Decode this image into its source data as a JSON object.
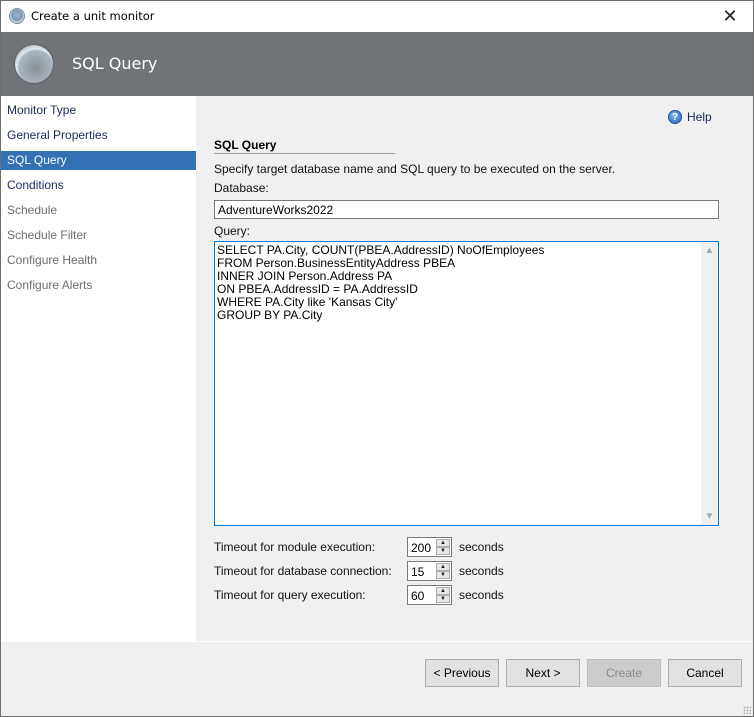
{
  "window": {
    "title": "Create a unit monitor",
    "close_glyph": "✕"
  },
  "header": {
    "title": "SQL Query"
  },
  "sidebar": {
    "items": [
      {
        "label": "Monitor Type",
        "state": "enabled"
      },
      {
        "label": "General Properties",
        "state": "enabled"
      },
      {
        "label": "SQL Query",
        "state": "selected"
      },
      {
        "label": "Conditions",
        "state": "enabled"
      },
      {
        "label": "Schedule",
        "state": "disabled"
      },
      {
        "label": "Schedule Filter",
        "state": "disabled"
      },
      {
        "label": "Configure Health",
        "state": "disabled"
      },
      {
        "label": "Configure Alerts",
        "state": "disabled"
      }
    ]
  },
  "main": {
    "help_label": "Help",
    "help_glyph": "?",
    "section_title": "SQL Query",
    "description": "Specify target database name and SQL query to be executed on the server.",
    "database_label": "Database:",
    "database_value": "AdventureWorks2022",
    "query_label": "Query:",
    "query_value": "SELECT PA.City, COUNT(PBEA.AddressID) NoOfEmployees\nFROM Person.BusinessEntityAddress PBEA\nINNER JOIN Person.Address PA\nON PBEA.AddressID = PA.AddressID\nWHERE PA.City like 'Kansas City'\nGROUP BY PA.City",
    "scroll_up_glyph": "▲",
    "scroll_down_glyph": "▼",
    "timeouts": [
      {
        "label": "Timeout for module execution:",
        "value": "200",
        "unit": "seconds"
      },
      {
        "label": "Timeout for database connection:",
        "value": "15",
        "unit": "seconds"
      },
      {
        "label": "Timeout for query execution:",
        "value": "60",
        "unit": "seconds"
      }
    ],
    "spin_up_glyph": "▲",
    "spin_down_glyph": "▼"
  },
  "footer": {
    "previous_label": "< Previous",
    "next_label": "Next >",
    "create_label": "Create",
    "cancel_label": "Cancel"
  }
}
